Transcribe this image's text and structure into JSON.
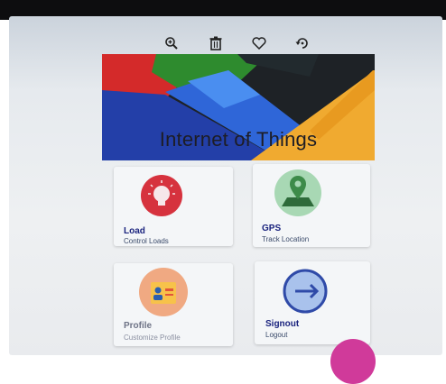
{
  "toolbar": {
    "icons": [
      "zoom-in-icon",
      "trash-icon",
      "heart-icon",
      "rotate-icon"
    ]
  },
  "banner": {
    "title": "Internet of Things"
  },
  "cards": [
    {
      "title": "Load",
      "subtitle": "Control Loads",
      "icon": "lightbulb-icon",
      "color": "#d6323e"
    },
    {
      "title": "GPS",
      "subtitle": "Track Location",
      "icon": "map-pin-icon",
      "color": "#a8d8b4"
    },
    {
      "title": "Profile",
      "subtitle": "Customize Profile",
      "icon": "id-card-icon",
      "color": "#f0a982"
    },
    {
      "title": "Signout",
      "subtitle": "Logout",
      "icon": "logout-icon",
      "color": "#2f4aa8"
    }
  ],
  "colors": {
    "accent": "#1a237e",
    "fab": "#d03a9a"
  }
}
